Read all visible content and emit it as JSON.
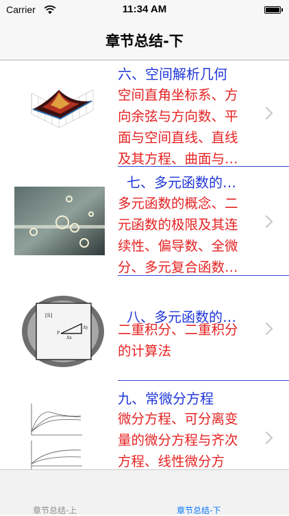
{
  "status": {
    "carrier": "Carrier",
    "time": "11:34 AM"
  },
  "nav": {
    "title": "章节总结-下"
  },
  "rows": [
    {
      "title": "六、空间解析几何",
      "desc": [
        "空间直角坐标系、方",
        "向余弦与方向数、平",
        "面与空间直线、直线",
        "及其方程、曲面与…"
      ]
    },
    {
      "title": "七、多元函数的…",
      "desc": [
        "多元函数的概念、二",
        "元函数的极限及其连",
        "续性、偏导数、全微",
        "分、多元复合函数…"
      ]
    },
    {
      "title": "八、多元函数的…",
      "desc": [
        "二重积分、二重积分",
        "的计算法"
      ]
    },
    {
      "title": "九、常微分方程",
      "desc": [
        "微分方程、可分离变",
        "量的微分方程与齐次",
        "方程、线性微分方"
      ]
    }
  ],
  "tabs": {
    "left": "章节总结-上",
    "right": "章节总结-下"
  },
  "colors": {
    "title_blue": "#1f36d8",
    "desc_red": "#e52222",
    "tab_active": "#0a7aff"
  }
}
